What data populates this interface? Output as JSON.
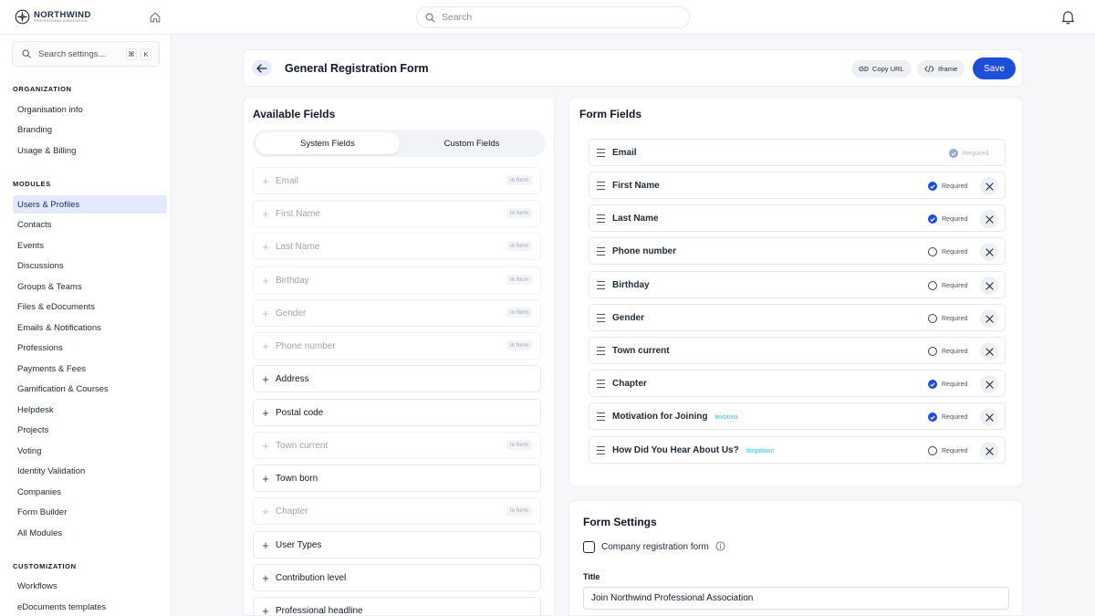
{
  "brand": {
    "name": "NORTHWIND",
    "tagline": "PROFESSIONAL ASSOCIATION"
  },
  "topbar": {
    "search_placeholder": "Search"
  },
  "sidebar": {
    "search_placeholder": "Search settings...",
    "shortcut_keys": [
      "⌘",
      "K"
    ],
    "sections": [
      {
        "title": "ORGANIZATION",
        "items": [
          "Organisation info",
          "Branding",
          "Usage & Billing"
        ]
      },
      {
        "title": "MODULES",
        "items": [
          "Users & Profiles",
          "Contacts",
          "Events",
          "Discussions",
          "Groups & Teams",
          "Files & eDocuments",
          "Emails & Notifications",
          "Professions",
          "Payments & Fees",
          "Gamification & Courses",
          "Helpdesk",
          "Projects",
          "Voting",
          "Identity Validation",
          "Companies",
          "Form Builder",
          "All Modules"
        ]
      },
      {
        "title": "CUSTOMIZATION",
        "items": [
          "Workflows",
          "eDocuments templates"
        ]
      }
    ],
    "active_item": "Users & Profiles"
  },
  "header": {
    "title": "General Registration Form",
    "copy_url": "Copy URL",
    "iframe": "Iframe",
    "save": "Save"
  },
  "available": {
    "title": "Available Fields",
    "tabs": [
      "System Fields",
      "Custom Fields"
    ],
    "in_form_label": "in form",
    "fields": [
      {
        "label": "Email",
        "in_form": true
      },
      {
        "label": "First Name",
        "in_form": true
      },
      {
        "label": "Last Name",
        "in_form": true
      },
      {
        "label": "Birthday",
        "in_form": true
      },
      {
        "label": "Gender",
        "in_form": true
      },
      {
        "label": "Phone number",
        "in_form": true
      },
      {
        "label": "Address",
        "in_form": false
      },
      {
        "label": "Postal code",
        "in_form": false
      },
      {
        "label": "Town current",
        "in_form": true
      },
      {
        "label": "Town born",
        "in_form": false
      },
      {
        "label": "Chapter",
        "in_form": true
      },
      {
        "label": "User Types",
        "in_form": false
      },
      {
        "label": "Contribution level",
        "in_form": false
      },
      {
        "label": "Professional headline",
        "in_form": false
      }
    ]
  },
  "form_fields": {
    "title": "Form Fields",
    "required_label": "Required",
    "fields": [
      {
        "label": "Email",
        "type": "",
        "required": true,
        "locked": true
      },
      {
        "label": "First Name",
        "type": "",
        "required": true,
        "locked": false
      },
      {
        "label": "Last Name",
        "type": "",
        "required": true,
        "locked": false
      },
      {
        "label": "Phone number",
        "type": "",
        "required": false,
        "locked": false
      },
      {
        "label": "Birthday",
        "type": "",
        "required": false,
        "locked": false
      },
      {
        "label": "Gender",
        "type": "",
        "required": false,
        "locked": false
      },
      {
        "label": "Town current",
        "type": "",
        "required": false,
        "locked": false
      },
      {
        "label": "Chapter",
        "type": "",
        "required": true,
        "locked": false
      },
      {
        "label": "Motivation for Joining",
        "type": "textarea",
        "required": true,
        "locked": false
      },
      {
        "label": "How Did You Hear About Us?",
        "type": "dropdown",
        "required": false,
        "locked": false
      }
    ]
  },
  "settings": {
    "title": "Form Settings",
    "company_checkbox_label": "Company registration form",
    "company_checked": false,
    "title_label": "Title",
    "title_value": "Join Northwind Professional Association"
  },
  "colors": {
    "accent": "#1d4ed8",
    "active_nav_bg": "#e3e8fa",
    "type_tag": "#38bdf8"
  }
}
